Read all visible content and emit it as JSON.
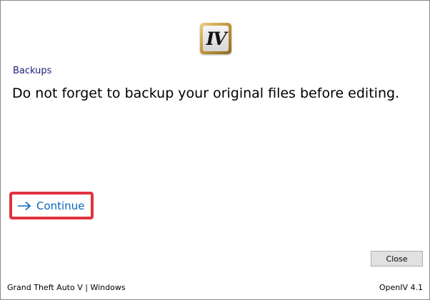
{
  "app": {
    "logo_icon": "openiv-logo-icon",
    "logo_glyph": "IV"
  },
  "content": {
    "section_title": "Backups",
    "message": "Do not forget to backup your original files before editing."
  },
  "actions": {
    "continue_label": "Continue",
    "continue_icon": "arrow-right-icon",
    "close_label": "Close"
  },
  "footer": {
    "game_platform": "Grand Theft Auto V | Windows",
    "app_version": "OpenIV 4.1"
  },
  "colors": {
    "section_title": "#1d1d7a",
    "link": "#0b66b8",
    "highlight": "#e0333f"
  }
}
